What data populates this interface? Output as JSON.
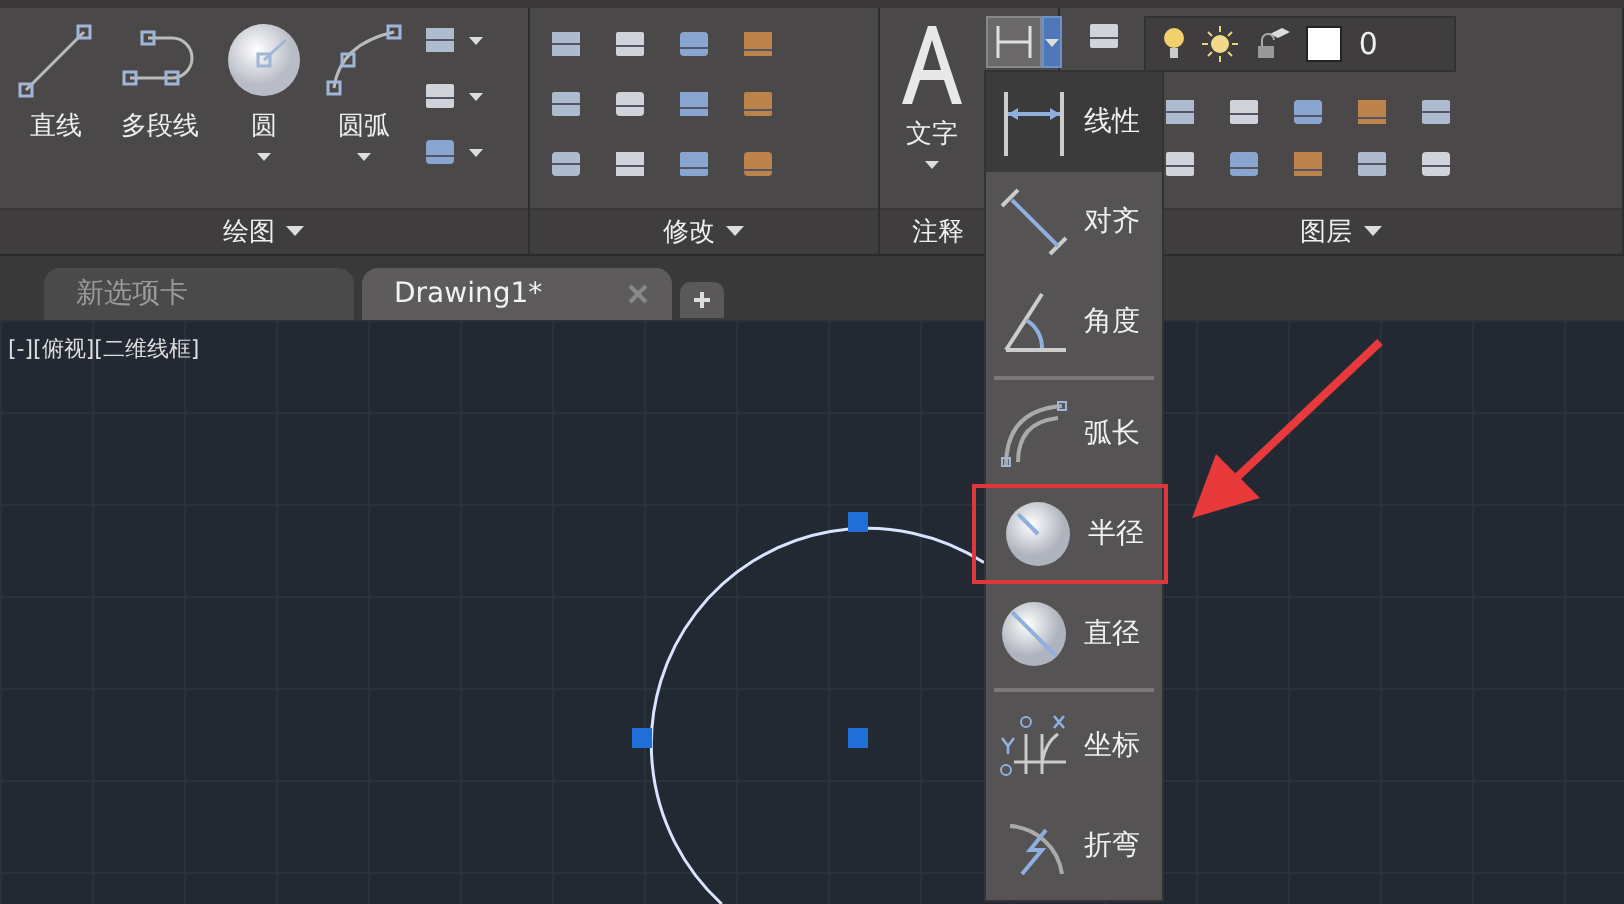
{
  "ribbon": {
    "panels": [
      {
        "kind": "draw",
        "title": "绘图",
        "large_buttons": [
          {
            "kind": "line",
            "label": "直线",
            "has_dropdown": false
          },
          {
            "kind": "polyline",
            "label": "多段线",
            "has_dropdown": false
          },
          {
            "kind": "circle",
            "label": "圆",
            "has_dropdown": true
          },
          {
            "kind": "arc",
            "label": "圆弧",
            "has_dropdown": true
          }
        ]
      },
      {
        "kind": "modify",
        "title": "修改"
      },
      {
        "kind": "annotation",
        "title": "注释",
        "large_buttons": [
          {
            "kind": "text",
            "label": "文字",
            "has_dropdown": true
          }
        ]
      },
      {
        "kind": "layers",
        "title": "图层",
        "layer_value": "0"
      }
    ]
  },
  "file_tabs": [
    {
      "label": "新选项卡",
      "selected": false,
      "closable": false
    },
    {
      "label": "Drawing1*",
      "selected": true,
      "closable": true
    }
  ],
  "viewport": {
    "label": "[-][俯视][二维线框]"
  },
  "dimension_menu": {
    "groups": [
      [
        {
          "kind": "linear",
          "label": "线性",
          "selected": true,
          "annotated": false
        },
        {
          "kind": "aligned",
          "label": "对齐",
          "selected": false,
          "annotated": false
        },
        {
          "kind": "angular",
          "label": "角度",
          "selected": false,
          "annotated": false
        }
      ],
      [
        {
          "kind": "arc-length",
          "label": "弧长",
          "selected": false,
          "annotated": false
        },
        {
          "kind": "radius",
          "label": "半径",
          "selected": false,
          "annotated": true
        },
        {
          "kind": "diameter",
          "label": "直径",
          "selected": false,
          "annotated": false
        }
      ],
      [
        {
          "kind": "ordinate",
          "label": "坐标",
          "selected": false,
          "annotated": false
        },
        {
          "kind": "jogged",
          "label": "折弯",
          "selected": false,
          "annotated": false
        }
      ]
    ]
  }
}
